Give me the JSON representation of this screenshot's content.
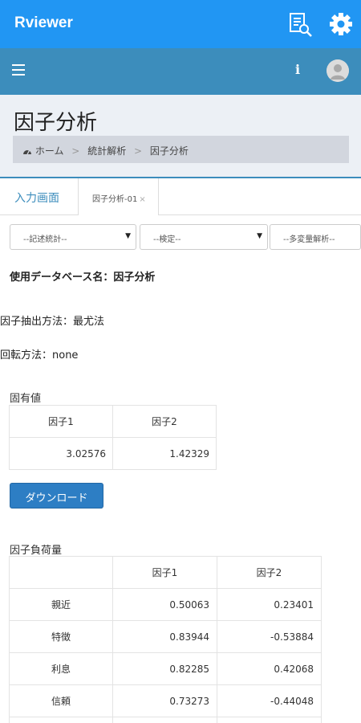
{
  "appbar": {
    "title": "Rviewer",
    "report_icon": "report-search-icon",
    "settings_icon": "gear-icon",
    "color": "#2196f3"
  },
  "navbar": {
    "menu_icon": "hamburger-menu-icon",
    "info_label": "i",
    "avatar_icon": "user-avatar-icon",
    "color": "#3c8dbc"
  },
  "page": {
    "title": "因子分析",
    "breadcrumb": {
      "home": "ホーム",
      "level2": "統計解析",
      "current": "因子分析",
      "home_icon": "dashboard-icon"
    }
  },
  "tabs": [
    {
      "label": "入力画面",
      "active": false
    },
    {
      "label": "因子分析-01",
      "active": true,
      "close": "×"
    }
  ],
  "selects": [
    {
      "value": "--記述統計--"
    },
    {
      "value": "--検定--"
    },
    {
      "value": "--多変量解析--"
    }
  ],
  "analysis": {
    "database_line": "使用データベース名：因子分析",
    "extraction_line": "因子抽出方法：最尤法",
    "rotation_line": "回転方法：none"
  },
  "eigen": {
    "label": "固有値",
    "headers": [
      "因子1",
      "因子2"
    ],
    "values": [
      "3.02576",
      "1.42329"
    ]
  },
  "download_label": "ダウンロード",
  "loadings": {
    "label": "因子負荷量",
    "headers": [
      "",
      "因子1",
      "因子2"
    ],
    "rows": [
      {
        "name": "親近",
        "f1": "0.50063",
        "f2": "0.23401"
      },
      {
        "name": "特徴",
        "f1": "0.83944",
        "f2": "-0.53884"
      },
      {
        "name": "利息",
        "f1": "0.82285",
        "f2": "0.42068"
      },
      {
        "name": "信頼",
        "f1": "0.73273",
        "f2": "-0.44048"
      }
    ]
  }
}
